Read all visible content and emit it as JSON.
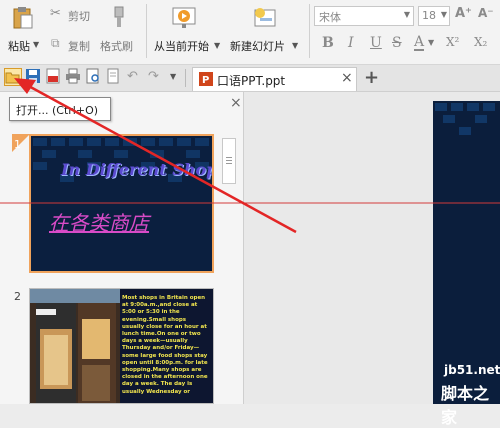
{
  "ribbon": {
    "paste_label": "粘贴",
    "cut_label": "剪切",
    "copy_label": "复制",
    "format_painter_label": "格式刷",
    "from_current_label": "从当前开始",
    "new_slide_label": "新建幻灯片",
    "font_name": "宋体",
    "font_size": "18",
    "bold": "B",
    "italic": "I",
    "underline": "U",
    "strike": "S",
    "font_color": "A",
    "superscript": "X²",
    "subscript": "X₂"
  },
  "tab": {
    "document_name": "口语PPT.ppt",
    "close_glyph": "×",
    "add_glyph": "+"
  },
  "tooltip": {
    "text": "打开... (Ctrl+O)"
  },
  "panel": {
    "close_glyph": "×"
  },
  "slides": [
    {
      "number": "1",
      "title_en": "In Different Shops",
      "title_cn": "在各类商店"
    },
    {
      "number": "2",
      "body": "Most shops in Britain open at 9:00a.m.,and close at 5:00 or 5:30 in the evening.Small shops usually close for an hour at lunch time.On one or two days a week—usually Thursday and/or Friday—some large food shops stay open until 8:00p.m. for late shopping.Many shops are closed in the afternoon one day a week. The day is usually Wednesday or"
    }
  ],
  "watermark": {
    "site": "jb51.net",
    "name": "脚本之家"
  },
  "colors": {
    "arrow": "#e32626",
    "slide_border_active": "#f0a35c",
    "slide_bg": "#0b1f3f"
  }
}
